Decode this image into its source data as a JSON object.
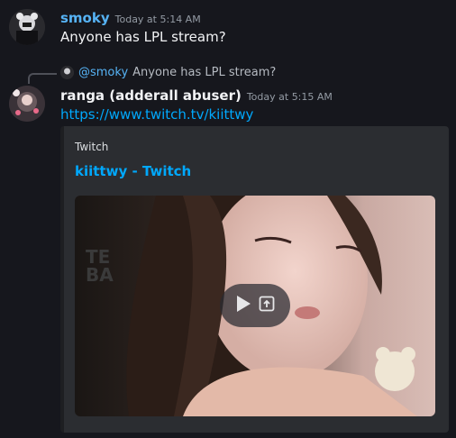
{
  "messages": [
    {
      "author": "smoky",
      "timestamp": "Today at 5:14 AM",
      "content": "Anyone has LPL stream?",
      "name_color": "#56b3f5"
    },
    {
      "author": "ranga (adderall abuser)",
      "timestamp": "Today at 5:15 AM",
      "link": "https://www.twitch.tv/kiittwy",
      "reply": {
        "mention": "@smoky",
        "quoted_text": "Anyone has LPL stream?"
      },
      "embed": {
        "provider": "Twitch",
        "title": "kiittwy - Twitch",
        "media": "video-thumbnail",
        "controls": [
          "play-icon",
          "open-external-icon"
        ]
      }
    }
  ],
  "colors": {
    "background": "#16171d",
    "link": "#00a8fc",
    "embed_bg": "#2b2d31"
  }
}
